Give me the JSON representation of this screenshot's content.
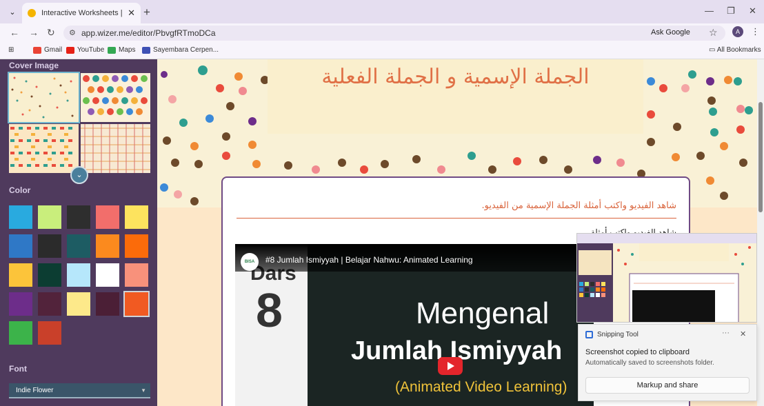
{
  "browser": {
    "tab_title": "Interactive Worksheets | Wizer.me",
    "url": "app.wizer.me/editor/PbvgfRTmoDCa",
    "ask_google": "Ask Google",
    "avatar_letter": "A",
    "bookmarks": [
      "Gmail",
      "YouTube",
      "Maps",
      "Sayembara Cerpen..."
    ],
    "all_bookmarks": "All Bookmarks"
  },
  "sidebar": {
    "cover_title": "Cover Image",
    "color_title": "Color",
    "font_title": "Font",
    "font_value": "Indie Flower",
    "swatches": [
      "#29aadf",
      "#c9ee7c",
      "#2e2e2e",
      "#f26e6b",
      "#fde35e",
      "#2f78c6",
      "#2b2b2b",
      "#1d5c63",
      "#fb8a1e",
      "#fb6b0a",
      "#fcc43a",
      "#0c3d32",
      "#b6e7fb",
      "#ffffff",
      "#f8917b",
      "#6d2d8a",
      "#52233b",
      "#fde98a",
      "#4b1f36",
      "#f15a22",
      "#3cb34a",
      "#c9402a"
    ],
    "selected_swatch": 19
  },
  "worksheet": {
    "title": "الجملة الإسمية و الجملة الفعلية",
    "question": "شاهد الفيديو واكتب أمثلة الجملة الإسمية من الفيديو.",
    "subtitle": "شاهد الفيديو واكتب أمثلة",
    "video": {
      "logo": "BISA",
      "title": "#8 Jumlah Ismiyyah | Belajar Nahwu: Animated Learning",
      "dars": "Dars",
      "num": "8",
      "mengenal": "Mengenal",
      "jumlah": "Jumlah Ismiyyah",
      "animated": "(Animated Video Learning)"
    }
  },
  "snipping": {
    "app": "Snipping Tool",
    "heading": "Screenshot copied to clipboard",
    "body": "Automatically saved to screenshots folder.",
    "button": "Markup and share"
  }
}
